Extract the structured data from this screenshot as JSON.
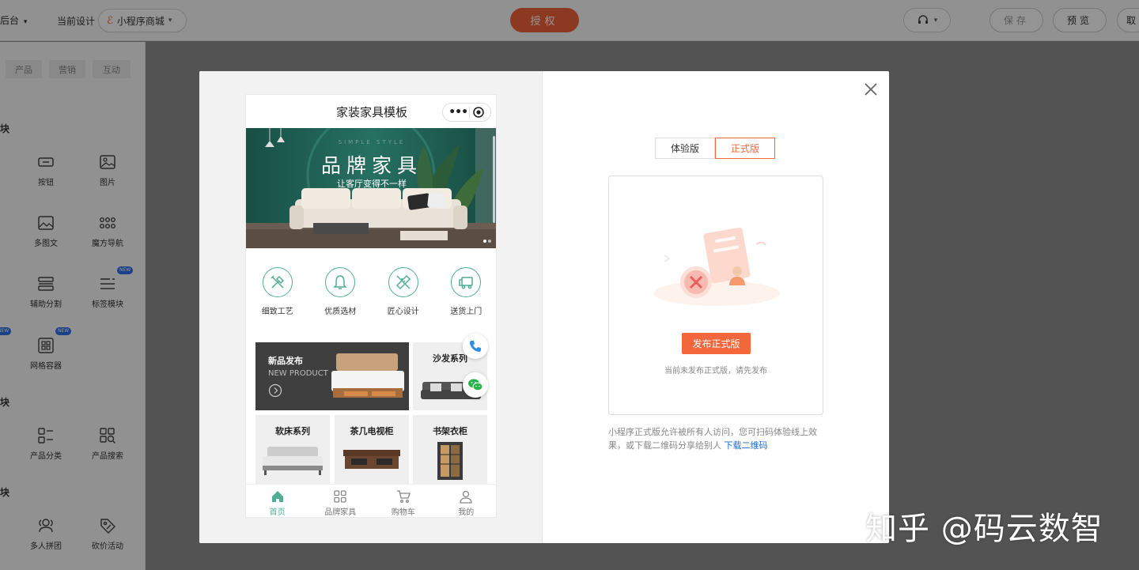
{
  "topbar": {
    "back_label": "回后台",
    "current_design_label": "当前设计",
    "design_select_value": "小程序商城",
    "authorize_label": "授权",
    "save_label": "保存",
    "preview_label": "预览",
    "more_label": "取"
  },
  "sidebar": {
    "tabs": [
      "产品",
      "营销",
      "互动"
    ],
    "section_labels": [
      "块",
      "块",
      "块"
    ],
    "tools": {
      "button": "按钮",
      "image": "图片",
      "multi_image_text": "多图文",
      "magic_nav": "魔方导航",
      "divider": "辅助分割",
      "tag_module": "标签模块",
      "grid_container": "网格容器",
      "product_category": "产品分类",
      "product_search": "产品搜索",
      "group_buy": "多人拼团",
      "bargain": "砍价活动"
    },
    "new_badge": "NEW"
  },
  "phone": {
    "title": "家装家具模板",
    "banner": {
      "subtitle_en": "SIMPLE STYLE",
      "title": "品牌家具",
      "subtitle": "让客厅变得不一样"
    },
    "features": [
      "细致工艺",
      "优质选材",
      "匠心设计",
      "送货上门"
    ],
    "products": {
      "new_title": "新品发布",
      "new_sub": "NEW PRODUCT",
      "sofa": "沙发系列",
      "bed": "软床系列",
      "tv": "茶几电视柜",
      "shelf": "书架衣柜"
    },
    "tabs": [
      "首页",
      "品牌家具",
      "购物车",
      "我的"
    ]
  },
  "panel": {
    "version_tabs": [
      "体验版",
      "正式版"
    ],
    "active_version": "正式版",
    "publish_button": "发布正式版",
    "not_published_hint": "当前未发布正式版，请先发布",
    "description": "小程序正式版允许被所有人访问，您可扫码体验线上效果，或下载二维码分享给别人",
    "download_link": "下载二维码"
  },
  "watermark": "知乎 @码云数智",
  "colors": {
    "accent": "#f0653a",
    "theme_green": "#4fae95",
    "link": "#1c6ad8"
  }
}
